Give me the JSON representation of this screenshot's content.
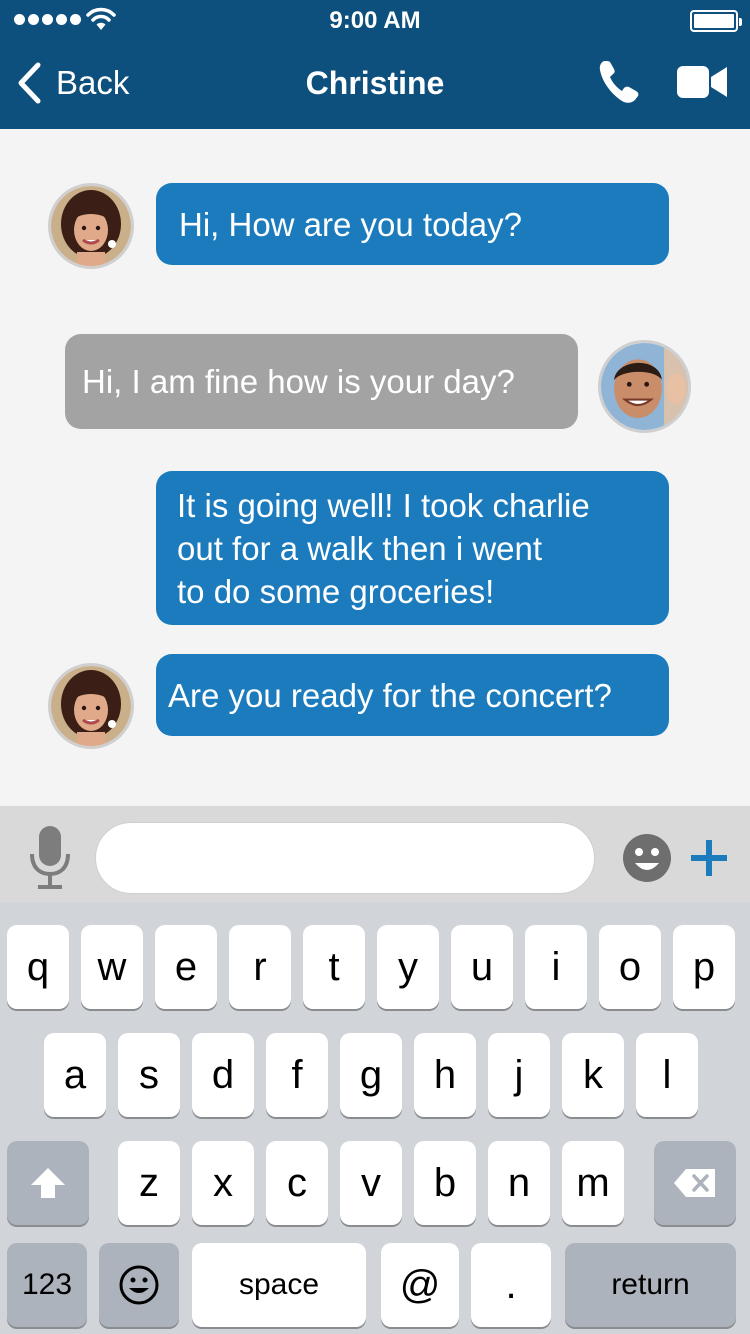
{
  "status_bar": {
    "time": "9:00 AM"
  },
  "nav": {
    "back_label": "Back",
    "title": "Christine"
  },
  "messages": [
    {
      "text": "Hi, How are you today?",
      "from": "Christine"
    },
    {
      "text": "Hi, I am fine how is your day?",
      "from": "me"
    },
    {
      "lines": [
        "It is going well! I took charlie",
        "out for a walk then i went",
        "to do some groceries!"
      ],
      "from": "Christine"
    },
    {
      "text": "Are you ready for the concert?",
      "from": "Christine"
    }
  ],
  "input": {
    "value": "",
    "placeholder": ""
  },
  "keyboard": {
    "row1": [
      "q",
      "w",
      "e",
      "r",
      "t",
      "y",
      "u",
      "i",
      "o",
      "p"
    ],
    "row2": [
      "a",
      "s",
      "d",
      "f",
      "g",
      "h",
      "j",
      "k",
      "l"
    ],
    "row3": [
      "z",
      "x",
      "c",
      "v",
      "b",
      "n",
      "m"
    ],
    "numbers_label": "123",
    "space_label": "space",
    "at_label": "@",
    "period_label": ".",
    "return_label": "return"
  },
  "colors": {
    "header": "#0d4f7d",
    "incoming_bubble": "#1b7bbd",
    "outgoing_bubble": "#a3a3a3",
    "accent": "#1b7bbd"
  },
  "icons": [
    "signal-icon",
    "wifi-icon",
    "battery-icon",
    "back-chevron-icon",
    "phone-icon",
    "video-camera-icon",
    "microphone-icon",
    "emoji-icon",
    "plus-icon",
    "shift-icon",
    "backspace-icon",
    "keyboard-emoji-icon"
  ]
}
